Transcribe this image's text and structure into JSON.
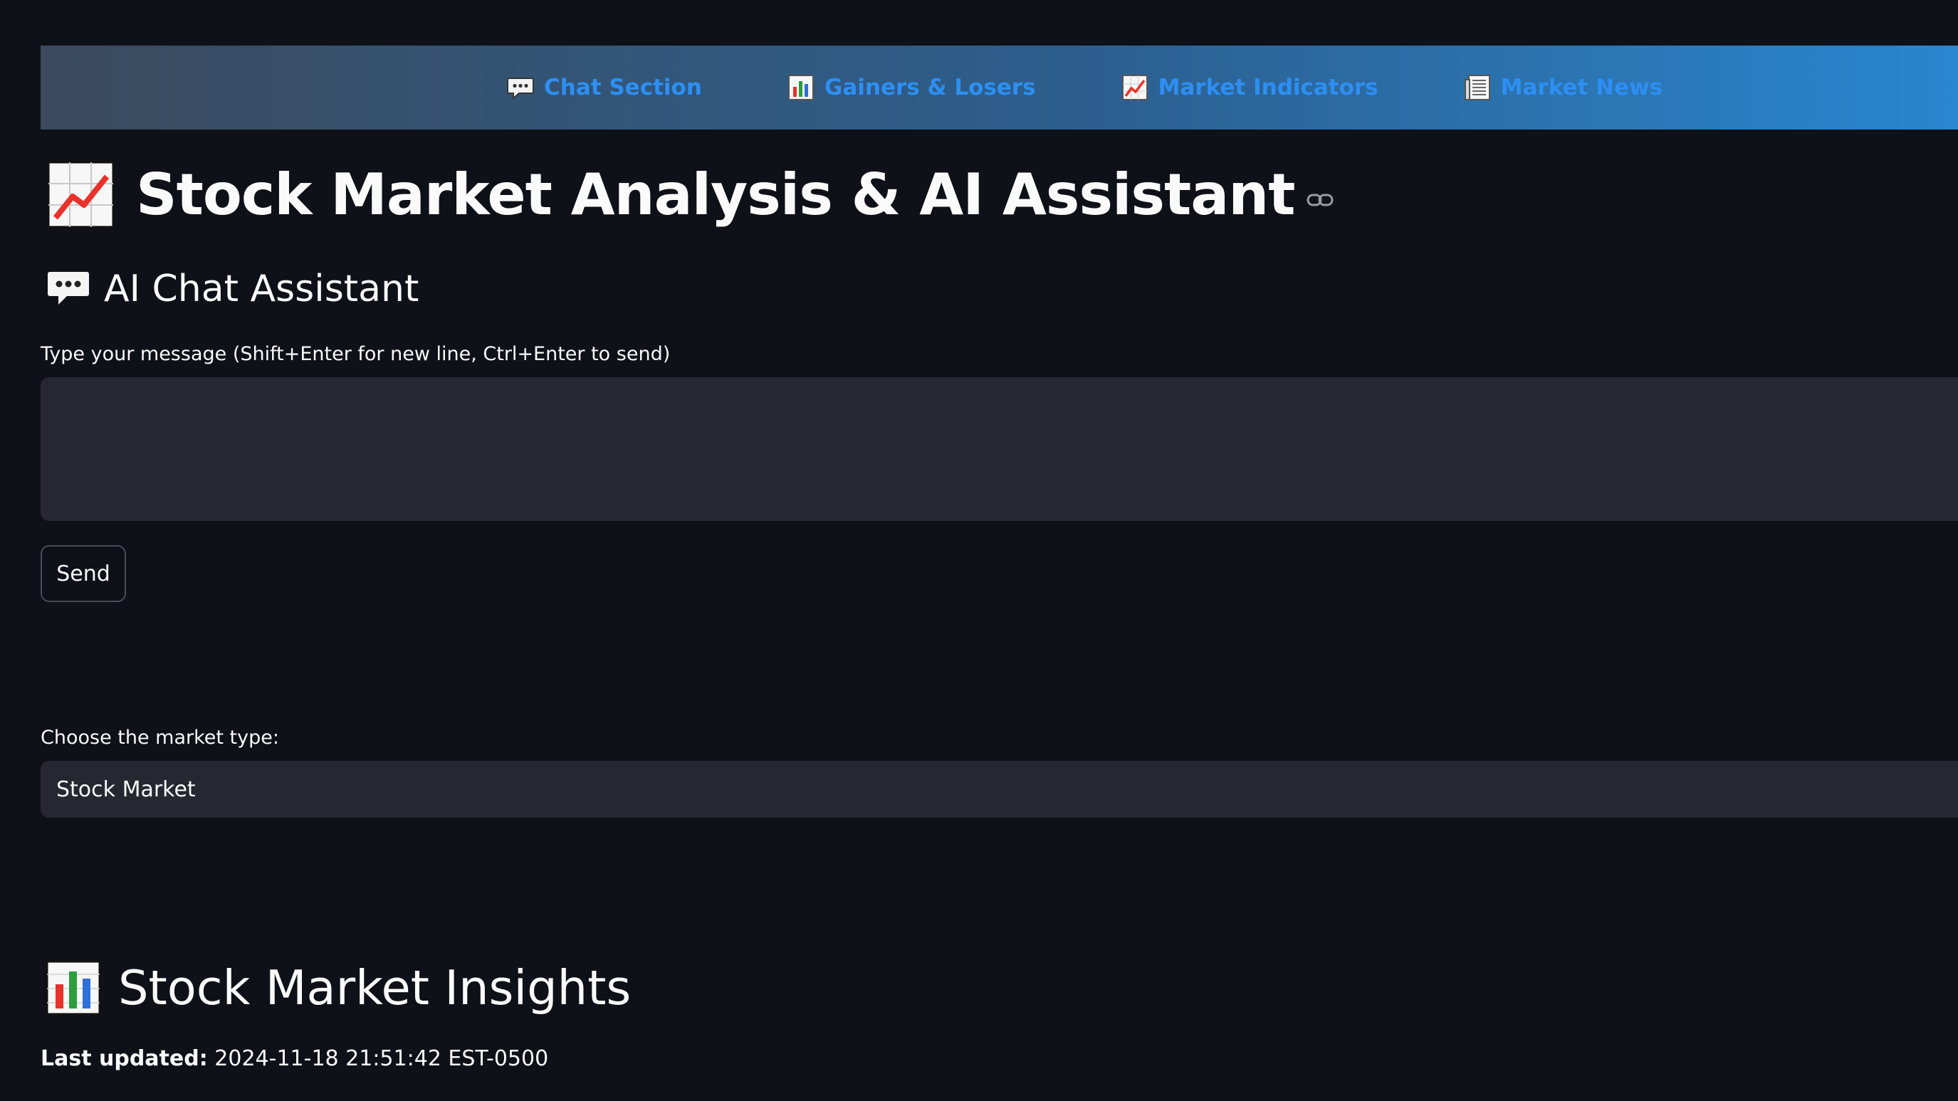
{
  "nav": {
    "items": [
      {
        "label": "Chat Section",
        "icon": "speech-bubble-icon"
      },
      {
        "label": "Gainers & Losers",
        "icon": "bar-chart-icon"
      },
      {
        "label": "Market Indicators",
        "icon": "chart-increasing-icon"
      },
      {
        "label": "Market News",
        "icon": "newspaper-icon"
      }
    ],
    "link_color": "#2e8ff2"
  },
  "title": {
    "text": "Stock Market Analysis & AI Assistant",
    "icon": "chart-increasing-icon"
  },
  "chat": {
    "header": "AI Chat Assistant",
    "header_icon": "speech-bubble-icon",
    "input_label": "Type your message (Shift+Enter for new line, Ctrl+Enter to send)",
    "input_value": "",
    "send_label": "Send"
  },
  "market": {
    "label": "Choose the market type:",
    "selected": "Stock Market"
  },
  "insights": {
    "header": "Stock Market Insights",
    "header_icon": "bar-chart-icon",
    "updated_label": "Last updated:",
    "updated_value": "2024-11-18 21:51:42 EST-0500"
  },
  "colors": {
    "background": "#0e1118",
    "input_bg": "#262730",
    "navbar_start": "#3b4a5d",
    "navbar_end": "#2a86cf"
  }
}
